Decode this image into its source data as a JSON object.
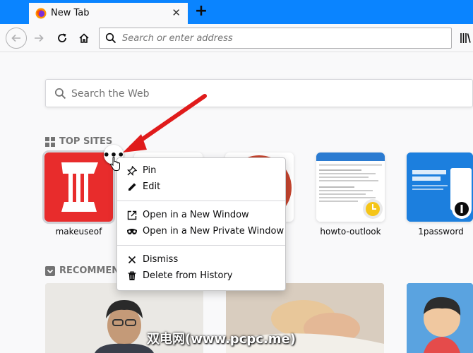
{
  "tab": {
    "title": "New Tab",
    "favicon": "firefox-icon"
  },
  "toolbar": {
    "url_placeholder": "Search or enter address"
  },
  "content": {
    "websearch_placeholder": "Search the Web",
    "topsites_title": "TOP SITES",
    "recommended_title": "RECOMMEND",
    "tiles": [
      {
        "label": "makeuseof"
      },
      {
        "label": ""
      },
      {
        "label": ""
      },
      {
        "label": "howto-outlook"
      },
      {
        "label": "1password"
      }
    ]
  },
  "context_menu": {
    "items": [
      {
        "label": "Pin",
        "icon": "pin-icon"
      },
      {
        "label": "Edit",
        "icon": "pencil-icon"
      },
      {
        "label": "Open in a New Window",
        "icon": "new-window-icon"
      },
      {
        "label": "Open in a New Private Window",
        "icon": "mask-icon"
      },
      {
        "label": "Dismiss",
        "icon": "close-icon"
      },
      {
        "label": "Delete from History",
        "icon": "trash-icon"
      }
    ]
  },
  "colors": {
    "accent": "#0a84ff",
    "annotation": "#e01b1b",
    "muo_red": "#e82c2c"
  },
  "watermark": "双电网(www.pcpc.me)"
}
